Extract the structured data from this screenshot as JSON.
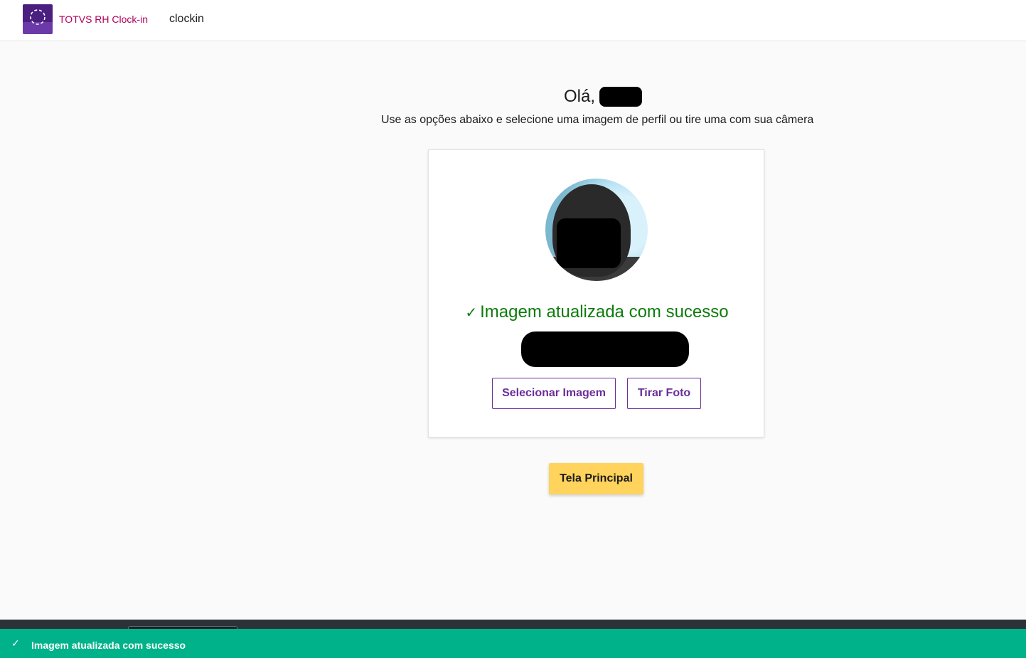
{
  "header": {
    "brand": "TOTVS RH Clock-in",
    "app_name": "clockin"
  },
  "profile": {
    "greeting": "Olá,",
    "instructions": "Use as opções abaixo e selecione uma imagem de perfil ou tire uma com sua câmera",
    "status_message": "Imagem atualizada com sucesso",
    "status_icon": "check-icon",
    "status_color": "#0c7b0c"
  },
  "actions": {
    "select_image": "Selecionar Imagem",
    "take_photo": "Tirar Foto",
    "main_screen": "Tela Principal"
  },
  "toast": {
    "message": "Imagem atualizada com sucesso",
    "icon": "check-icon",
    "color": "#00b28a"
  },
  "colors": {
    "brand": "#b0005c",
    "accent": "#6b2d9a",
    "primary_button": "#ffd35c"
  }
}
